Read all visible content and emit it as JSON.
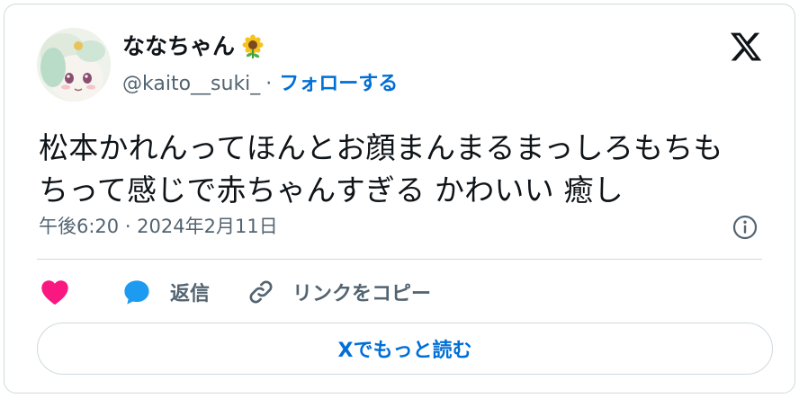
{
  "author": {
    "display_name": "ななちゃん",
    "name_emoji": "sunflower-icon",
    "handle": "@kaito__suki_",
    "separator": "·",
    "follow_label": "フォローする"
  },
  "tweet": {
    "text": "松本かれんってほんとお顔まんまるまっしろもちも\nちって感じで赤ちゃんすぎる かわいい 癒し",
    "timestamp": "午後6:20 · 2024年2月11日"
  },
  "actions": {
    "like_label": "",
    "reply_label": "返信",
    "copy_link_label": "リンクをコピー"
  },
  "read_more_label": "Xでもっと読む",
  "colors": {
    "text": "#0f1419",
    "secondary": "#536471",
    "link": "#006fd6",
    "like": "#f91880",
    "reply": "#1d9bf0",
    "border": "#cfd9de"
  }
}
